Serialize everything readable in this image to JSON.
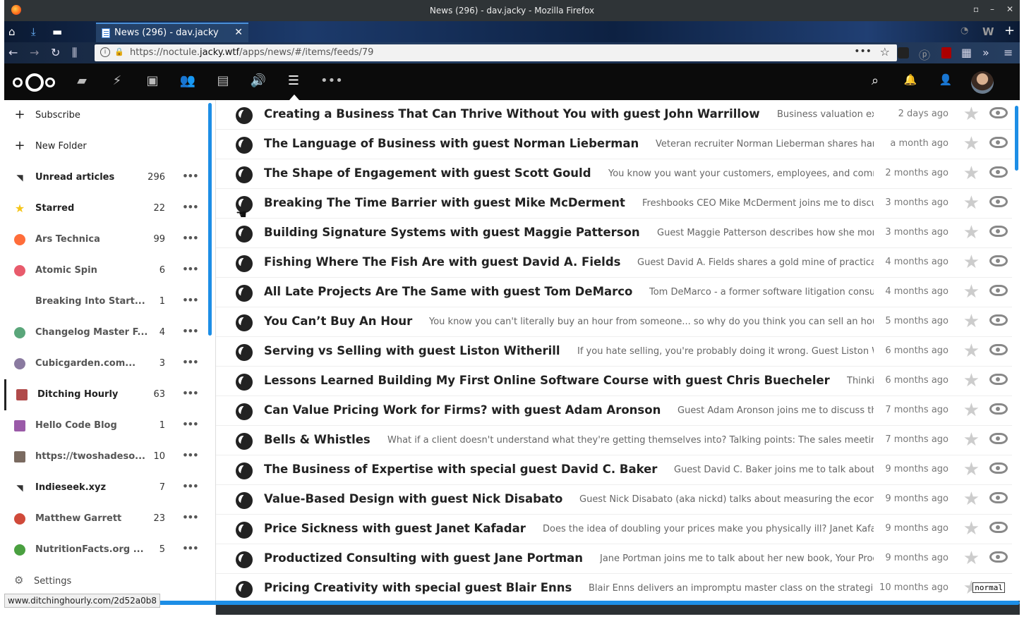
{
  "window": {
    "title": "News (296) - dav.jacky - Mozilla Firefox"
  },
  "browser": {
    "tab_title": "News (296) - dav.jacky",
    "url_prefix": "https://noctule.",
    "url_domain": "jacky.wtf",
    "url_path": "/apps/news/#/items/feeds/79",
    "status_url": "www.ditchinghourly.com/2d52a0b8"
  },
  "sidebar": {
    "subscribe": "Subscribe",
    "new_folder": "New Folder",
    "settings": "Settings",
    "feeds": [
      {
        "label": "Unread articles",
        "count": "296",
        "icon": "rss-icon",
        "color": "#333333"
      },
      {
        "label": "Starred",
        "count": "22",
        "icon": "star-icon",
        "color": "#f5c518"
      },
      {
        "label": "Ars Technica",
        "count": "99",
        "icon": "ars-icon",
        "color": "#ff6d3a"
      },
      {
        "label": "Atomic Spin",
        "count": "6",
        "icon": "atomic-icon",
        "color": "#e85b6c"
      },
      {
        "label": "Breaking Into Start...",
        "count": "1",
        "icon": "",
        "color": ""
      },
      {
        "label": "Changelog Master F...",
        "count": "4",
        "icon": "changelog-icon",
        "color": "#5aa67a"
      },
      {
        "label": "Cubicgarden.com...",
        "count": "3",
        "icon": "cubicgarden-icon",
        "color": "#8a7aa0"
      },
      {
        "label": "Ditching Hourly",
        "count": "63",
        "icon": "ditching-hourly-icon",
        "color": "#b04a4a"
      },
      {
        "label": "Hello Code Blog",
        "count": "1",
        "icon": "hello-code-icon",
        "color": "#9a5aa8"
      },
      {
        "label": "https://twoshadeso...",
        "count": "10",
        "icon": "twoshades-icon",
        "color": "#7a6a60"
      },
      {
        "label": "Indieseek.xyz",
        "count": "7",
        "icon": "rss-icon",
        "color": "#333333"
      },
      {
        "label": "Matthew Garrett",
        "count": "23",
        "icon": "spiral-icon",
        "color": "#d04a3a"
      },
      {
        "label": "NutritionFacts.org ...",
        "count": "5",
        "icon": "nutrition-icon",
        "color": "#4aa040"
      }
    ]
  },
  "articles": [
    {
      "title": "Creating a Business That Can Thrive Without You with guest John Warrillow",
      "body": "Business valuation expert John Warrillow shares how to build a business that can thrive without you",
      "date": "2 days ago"
    },
    {
      "title": "The Language of Business with guest Norman Lieberman",
      "body": "Veteran recruiter Norman Lieberman shares hard won war stories",
      "date": "a month ago"
    },
    {
      "title": "The Shape of Engagement with guest Scott Gould",
      "body": "You know you want your customers, employees, and communities to be engaged",
      "date": "2 months ago"
    },
    {
      "title": "Breaking The Time Barrier with guest Mike McDerment",
      "body": "Freshbooks CEO Mike McDerment joins me to discuss his book Breaking The Time Barrier",
      "date": "3 months ago"
    },
    {
      "title": "Building Signature Systems with guest Maggie Patterson",
      "body": "Guest Maggie Patterson describes how she more than doubled her income",
      "date": "3 months ago"
    },
    {
      "title": "Fishing Where The Fish Are with guest David A. Fields",
      "body": "Guest David A. Fields shares a gold mine of practical advice on outreach",
      "date": "4 months ago"
    },
    {
      "title": "All Late Projects Are The Same with guest Tom DeMarco",
      "body": "Tom DeMarco - a former software litigation consultant - explains why",
      "date": "4 months ago"
    },
    {
      "title": "You Can’t Buy An Hour",
      "body": "You know you can't literally buy an hour from someone... so why do you think you can sell an hour to someone else",
      "date": "5 months ago"
    },
    {
      "title": "Serving vs Selling with guest Liston Witherill",
      "body": "If you hate selling, you're probably doing it wrong. Guest Liston Witherill joins me to",
      "date": "6 months ago"
    },
    {
      "title": "Lessons Learned Building My First Online Software Course with guest Chris Buecheler",
      "body": "Thinking of monetizing your",
      "date": "6 months ago"
    },
    {
      "title": "Can Value Pricing Work for Firms? with guest Adam Aronson",
      "body": "Guest Adam Aronson joins me to discuss the feasibility of value pricing",
      "date": "7 months ago"
    },
    {
      "title": "Bells & Whistles",
      "body": "What if a client doesn't understand what they're getting themselves into? Talking points: The sales meeting is not over until",
      "date": "7 months ago"
    },
    {
      "title": "The Business of Expertise with special guest David C. Baker",
      "body": "Guest David C. Baker joins me to talk about expertise, positioning",
      "date": "9 months ago"
    },
    {
      "title": "Value-Based Design with guest Nick Disabato",
      "body": "Guest Nick Disabato (aka nickd) talks about measuring the economic value of design",
      "date": "9 months ago"
    },
    {
      "title": "Price Sickness with guest Janet Kafadar",
      "body": "Does the idea of doubling your prices make you physically ill? Janet Kafadar shares a very",
      "date": "9 months ago"
    },
    {
      "title": "Productized Consulting with guest Jane Portman",
      "body": "Jane Portman joins me to talk about her new book, Your Productized Consulting",
      "date": "9 months ago"
    },
    {
      "title": "Pricing Creativity with special guest Blair Enns",
      "body": "Blair Enns delivers an impromptu master class on the strategies and tactics of value pricing",
      "date": "10 months ago"
    }
  ],
  "tooltip": "normal"
}
